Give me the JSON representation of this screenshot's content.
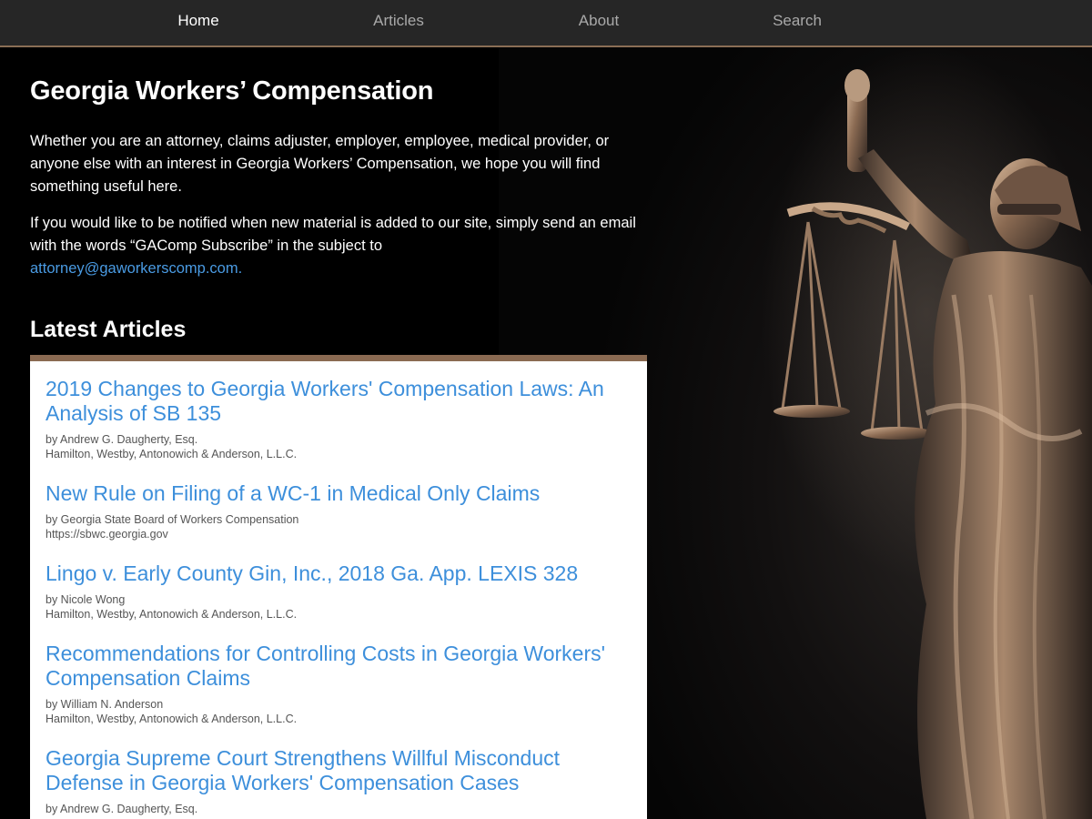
{
  "nav": {
    "items": [
      {
        "label": "Home",
        "active": true
      },
      {
        "label": "Articles",
        "active": false
      },
      {
        "label": "About",
        "active": false
      },
      {
        "label": "Search",
        "active": false
      }
    ]
  },
  "header": {
    "title": "Georgia Workers’ Compensation"
  },
  "intro": {
    "paragraph1": "Whether you are an attorney, claims adjuster, employer, employee, medical provider, or anyone else with an interest in Georgia Workers’ Compensation, we hope you will find something useful here.",
    "paragraph2": "If you would like to be notified when new material is added to our site, simply send an email with the words “GAComp Subscribe” in the subject to",
    "email_link": "attorney@gaworkerscomp.com."
  },
  "latest": {
    "heading": "Latest Articles",
    "articles": [
      {
        "title": "2019 Changes to Georgia Workers' Compensation Laws: An Analysis of SB 135",
        "author": "by Andrew G. Daugherty, Esq.",
        "org": "Hamilton, Westby, Antonowich & Anderson, L.L.C."
      },
      {
        "title": "New Rule on Filing of a WC-1 in Medical Only Claims",
        "author": "by Georgia State Board of Workers Compensation",
        "org": "https://sbwc.georgia.gov"
      },
      {
        "title": "Lingo v. Early County Gin, Inc., 2018 Ga. App. LEXIS 328",
        "author": "by Nicole Wong",
        "org": "Hamilton, Westby, Antonowich & Anderson, L.L.C."
      },
      {
        "title": "Recommendations for Controlling Costs in Georgia Workers' Compensation Claims",
        "author": "by William N. Anderson",
        "org": "Hamilton, Westby, Antonowich & Anderson, L.L.C."
      },
      {
        "title": "Georgia Supreme Court Strengthens Willful Misconduct Defense in Georgia Workers' Compensation Cases",
        "author": "by Andrew G. Daugherty, Esq.",
        "org": ""
      }
    ]
  },
  "colors": {
    "nav_bg": "#262626",
    "nav_border": "#8a6e55",
    "link": "#3d8fdb",
    "panel_border": "#8a6a52"
  }
}
